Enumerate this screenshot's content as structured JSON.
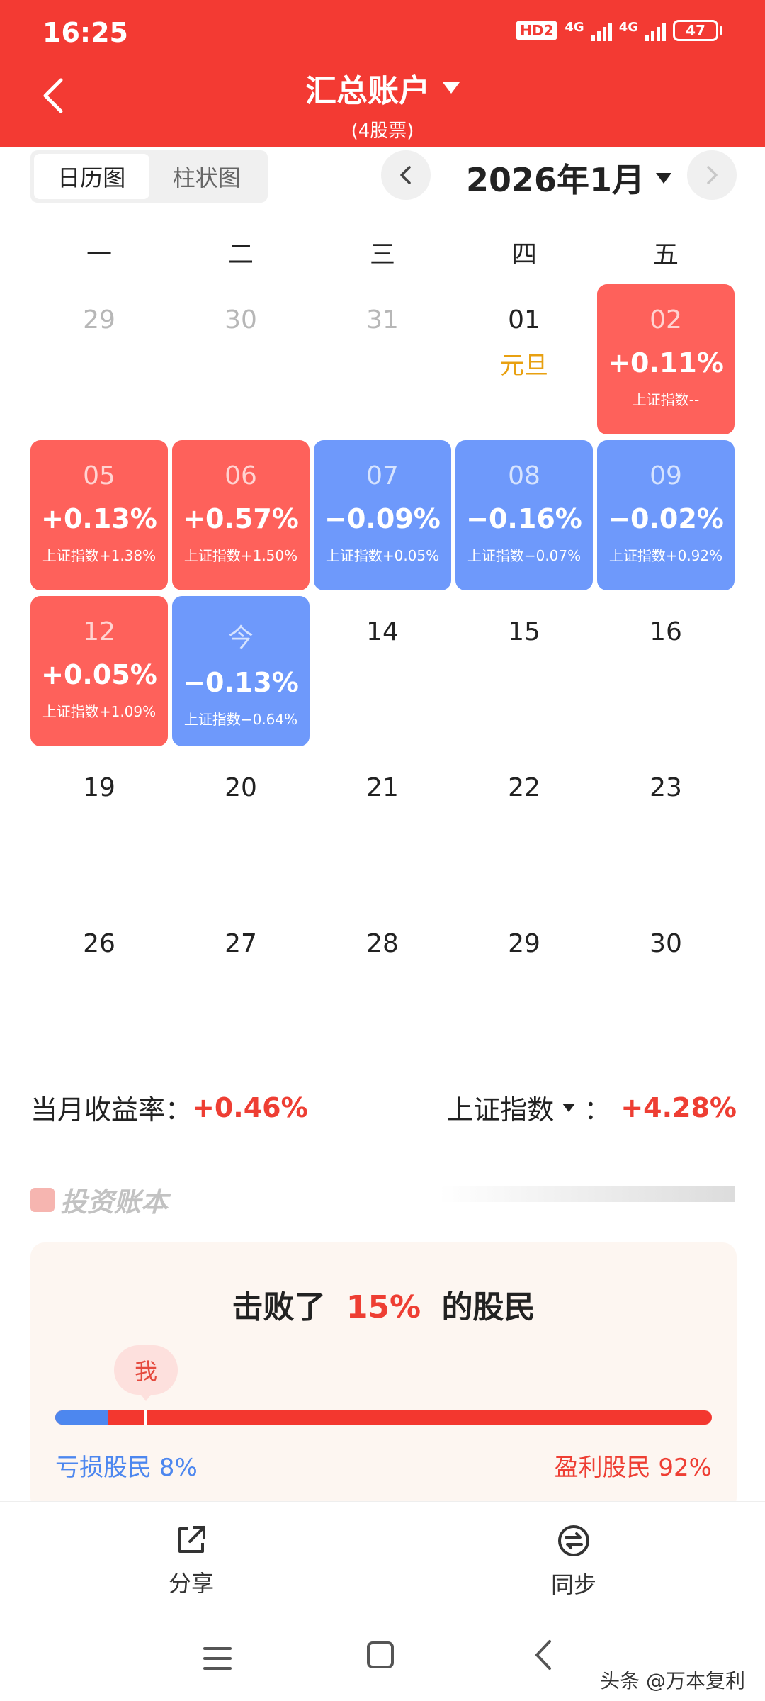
{
  "status": {
    "time": "16:25",
    "hd": "HD2",
    "net1": "4G",
    "net2": "4G",
    "battery": "47"
  },
  "header": {
    "title": "汇总账户",
    "subtitle": "(4股票)"
  },
  "tabs": [
    {
      "label": "日历图",
      "active": true
    },
    {
      "label": "柱状图",
      "active": false
    }
  ],
  "month": {
    "label": "2026年1月"
  },
  "weekdays": [
    "一",
    "二",
    "三",
    "四",
    "五"
  ],
  "calendar": [
    [
      {
        "day": "29",
        "state": "muted"
      },
      {
        "day": "30",
        "state": "muted"
      },
      {
        "day": "31",
        "state": "muted"
      },
      {
        "day": "01",
        "state": "holiday",
        "note": "元旦"
      },
      {
        "day": "02",
        "state": "up",
        "pct": "+0.11%",
        "idx": "上证指数--"
      }
    ],
    [
      {
        "day": "05",
        "state": "up",
        "pct": "+0.13%",
        "idx": "上证指数+1.38%"
      },
      {
        "day": "06",
        "state": "up",
        "pct": "+0.57%",
        "idx": "上证指数+1.50%"
      },
      {
        "day": "07",
        "state": "down",
        "pct": "−0.09%",
        "idx": "上证指数+0.05%"
      },
      {
        "day": "08",
        "state": "down",
        "pct": "−0.16%",
        "idx": "上证指数−0.07%"
      },
      {
        "day": "09",
        "state": "down",
        "pct": "−0.02%",
        "idx": "上证指数+0.92%"
      }
    ],
    [
      {
        "day": "12",
        "state": "up",
        "pct": "+0.05%",
        "idx": "上证指数+1.09%"
      },
      {
        "day": "今",
        "state": "down",
        "pct": "−0.13%",
        "idx": "上证指数−0.64%"
      },
      {
        "day": "14",
        "state": "plain"
      },
      {
        "day": "15",
        "state": "plain"
      },
      {
        "day": "16",
        "state": "plain"
      }
    ],
    [
      {
        "day": "19",
        "state": "plain"
      },
      {
        "day": "20",
        "state": "plain"
      },
      {
        "day": "21",
        "state": "plain"
      },
      {
        "day": "22",
        "state": "plain"
      },
      {
        "day": "23",
        "state": "plain"
      }
    ],
    [
      {
        "day": "26",
        "state": "plain"
      },
      {
        "day": "27",
        "state": "plain"
      },
      {
        "day": "28",
        "state": "plain"
      },
      {
        "day": "29",
        "state": "plain"
      },
      {
        "day": "30",
        "state": "plain"
      }
    ]
  ],
  "summary": {
    "monthly_label": "当月收益率：",
    "monthly_value": "+0.46%",
    "index_label": "上证指数",
    "index_sep": "：",
    "index_value": "+4.28%"
  },
  "watermark": {
    "text": "投资账本"
  },
  "ranking": {
    "title_prefix": "击败了",
    "title_value": "15%",
    "title_suffix": "的股民",
    "me_label": "我",
    "loss_label": "亏损股民 8%",
    "gain_label": "盈利股民 92%",
    "loss_fraction": 0.08,
    "me_fraction": 0.135
  },
  "actions": {
    "share": "分享",
    "sync": "同步"
  },
  "credit": "头条 @万本复利",
  "colors": {
    "brand": "#f33a33",
    "up": "#fe615b",
    "down": "#6e99fb",
    "holiday": "#e8a010"
  }
}
